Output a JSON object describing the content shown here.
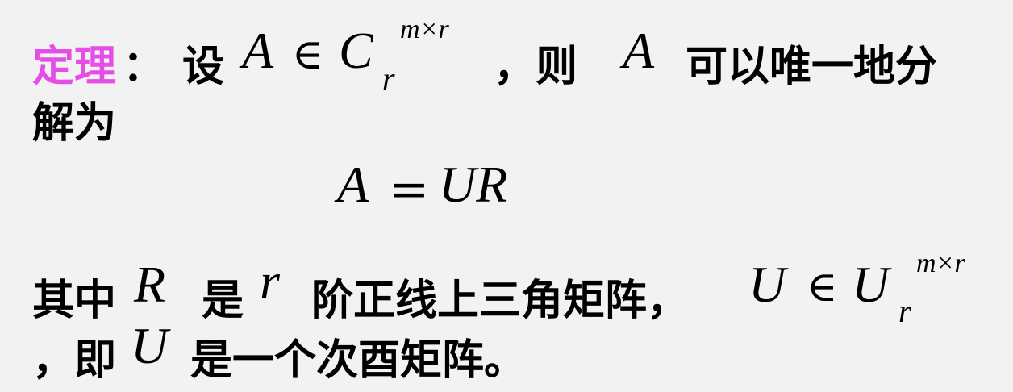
{
  "theorem": {
    "label": "定理",
    "colon": "：",
    "she": "设",
    "A1": "A",
    "in1": "∈",
    "C": "C",
    "C_sup": "m×r",
    "C_sub": "r",
    "comma_ze": "，则",
    "A2": "A",
    "rest1": "可以唯一地分",
    "line2": "解为"
  },
  "formula": {
    "A": "A",
    "eq": "=",
    "UR": "UR"
  },
  "statement": {
    "qizhong": "其中",
    "R": "R",
    "shi1": "是",
    "r": "r",
    "mid": "阶正线上三角矩阵，",
    "U1": "U",
    "in2": "∈",
    "U2": "U",
    "U_sup": "m×r",
    "U_sub": "r",
    "line4_start": "，即",
    "U3": "U",
    "line4_end": "是一个次酉矩阵。"
  },
  "colors": {
    "background": "#f2f2f2",
    "accent": "#e64de6",
    "text": "#000000"
  }
}
